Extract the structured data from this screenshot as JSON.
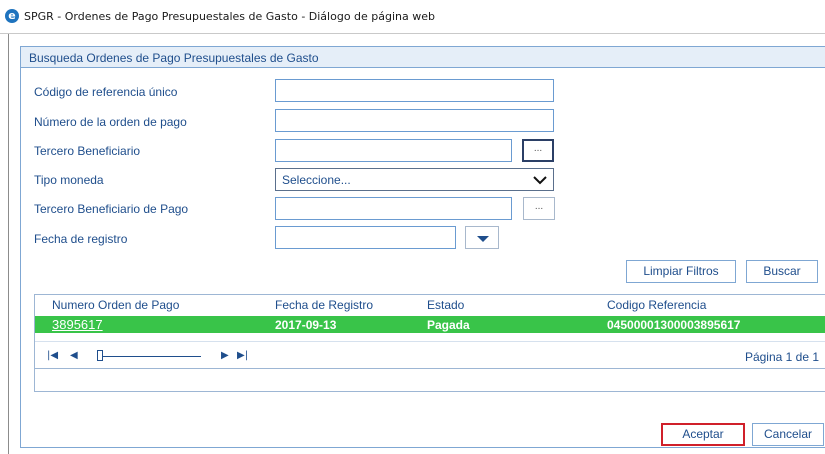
{
  "window": {
    "title": "SPGR - Ordenes de Pago Presupuestales de Gasto - Diálogo de página web",
    "icon": "ie-icon"
  },
  "panel": {
    "title": "Busqueda Ordenes de Pago Presupuestales de Gasto"
  },
  "form": {
    "codigo_label": "Código de referencia único",
    "codigo_value": "",
    "numero_label": "Número de la orden de pago",
    "numero_value": "",
    "tercero_label": "Tercero Beneficiario",
    "tercero_value": "",
    "tercero_btn": "...",
    "moneda_label": "Tipo moneda",
    "moneda_value": "Seleccione...",
    "tercero_pago_label": "Tercero Beneficiario de Pago",
    "tercero_pago_value": "",
    "tercero_pago_btn": "...",
    "fecha_label": "Fecha de registro",
    "fecha_value": ""
  },
  "actions": {
    "limpiar": "Limpiar Filtros",
    "buscar": "Buscar"
  },
  "grid": {
    "columns": [
      "Numero Orden de Pago",
      "Fecha de Registro",
      "Estado",
      "Codigo Referencia"
    ],
    "rows": [
      [
        "3895617",
        "2017-09-13",
        "Pagada",
        "04500001300003895617"
      ]
    ],
    "page_info": "Página 1 de 1"
  },
  "footer": {
    "aceptar": "Aceptar",
    "cancelar": "Cancelar"
  },
  "colors": {
    "label": "#1f4e8c",
    "border": "#7fa7d3",
    "selected_row": "#39c449",
    "highlight": "#d0202a"
  }
}
